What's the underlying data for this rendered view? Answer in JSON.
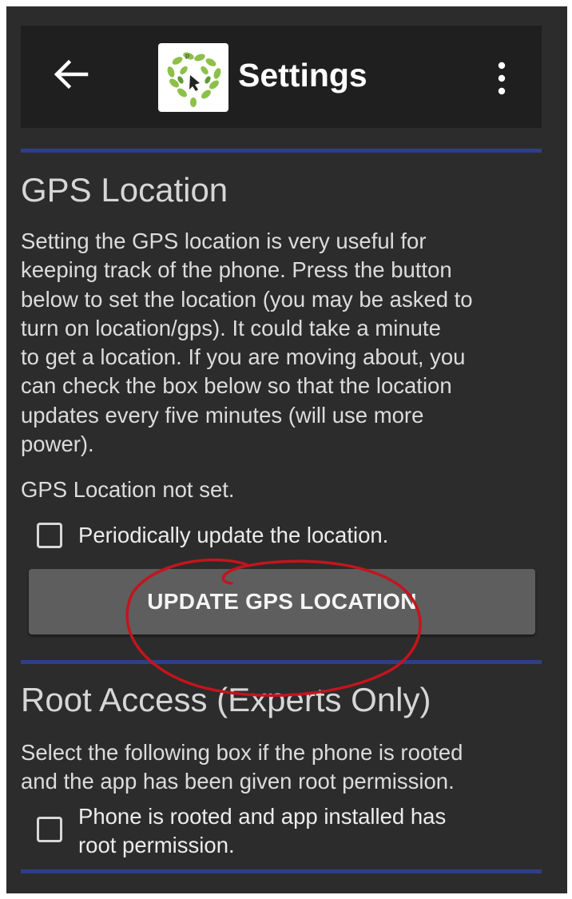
{
  "app_bar": {
    "back_icon": "arrow-back-icon",
    "logo_icon": "app-logo-heart-leaves",
    "title": "Settings",
    "menu_icon": "more-vert-icon"
  },
  "gps_section": {
    "heading": "GPS Location",
    "description_lines": [
      "Setting the GPS location is very useful for",
      "keeping track of the phone. Press the button",
      "below to set the location (you may be asked to",
      "turn on location/gps). It could take a minute",
      "to get a location. If you are moving about, you",
      "can check the box below so that the location",
      "updates every five minutes (will use more",
      "power)."
    ],
    "status": "GPS Location not set.",
    "periodic_checkbox_label": "Periodically update the location.",
    "periodic_checked": false,
    "button_label": "UPDATE GPS LOCATION"
  },
  "root_section": {
    "heading": "Root Access (Experts Only)",
    "description_lines": [
      "Select the following box if the phone is rooted",
      "and the app has been given root permission."
    ],
    "root_checkbox_label_lines": [
      "Phone is rooted and app installed has",
      "root permission."
    ],
    "root_checked": false
  },
  "colors": {
    "background": "#2c2c2c",
    "app_bar": "#1f1f1f",
    "divider": "#2f3f86",
    "button": "#5e5e5e",
    "annotation": "#c4141c"
  }
}
